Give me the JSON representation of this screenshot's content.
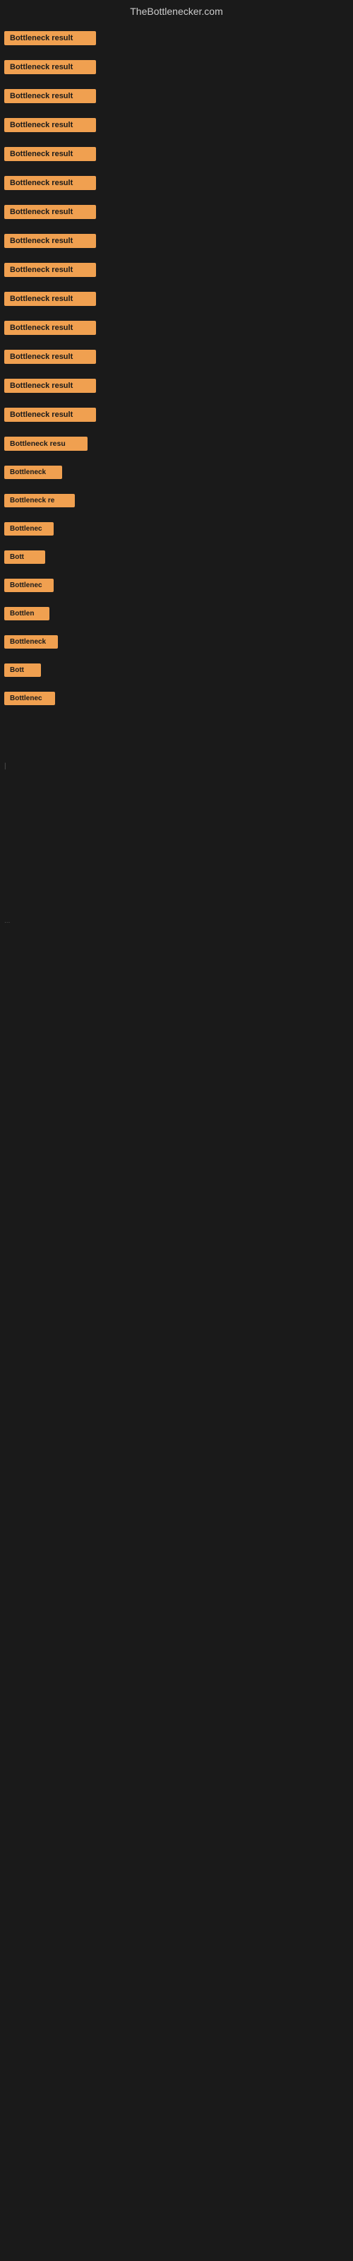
{
  "header": {
    "title": "TheBottlenecker.com"
  },
  "colors": {
    "badge_bg": "#f0a050",
    "badge_text": "#1a1a1a",
    "page_bg": "#1a1a1a"
  },
  "rows": [
    {
      "id": 1,
      "label": "Bottleneck result",
      "width": 130
    },
    {
      "id": 2,
      "label": "Bottleneck result",
      "width": 130
    },
    {
      "id": 3,
      "label": "Bottleneck result",
      "width": 130
    },
    {
      "id": 4,
      "label": "Bottleneck result",
      "width": 130
    },
    {
      "id": 5,
      "label": "Bottleneck result",
      "width": 130
    },
    {
      "id": 6,
      "label": "Bottleneck result",
      "width": 130
    },
    {
      "id": 7,
      "label": "Bottleneck result",
      "width": 130
    },
    {
      "id": 8,
      "label": "Bottleneck result",
      "width": 130
    },
    {
      "id": 9,
      "label": "Bottleneck result",
      "width": 130
    },
    {
      "id": 10,
      "label": "Bottleneck result",
      "width": 130
    },
    {
      "id": 11,
      "label": "Bottleneck result",
      "width": 130
    },
    {
      "id": 12,
      "label": "Bottleneck result",
      "width": 130
    },
    {
      "id": 13,
      "label": "Bottleneck result",
      "width": 130
    },
    {
      "id": 14,
      "label": "Bottleneck result",
      "width": 130
    },
    {
      "id": 15,
      "label": "Bottleneck resu",
      "width": 118
    },
    {
      "id": 16,
      "label": "Bottleneck",
      "width": 82
    },
    {
      "id": 17,
      "label": "Bottleneck re",
      "width": 100
    },
    {
      "id": 18,
      "label": "Bottlenec",
      "width": 70
    },
    {
      "id": 19,
      "label": "Bott",
      "width": 52
    },
    {
      "id": 20,
      "label": "Bottlenec",
      "width": 70
    },
    {
      "id": 21,
      "label": "Bottlen",
      "width": 64
    },
    {
      "id": 22,
      "label": "Bottleneck",
      "width": 76
    },
    {
      "id": 23,
      "label": "Bott",
      "width": 52
    },
    {
      "id": 24,
      "label": "Bottlenec",
      "width": 70
    }
  ],
  "small_marker": "|",
  "small_marker2": "..."
}
